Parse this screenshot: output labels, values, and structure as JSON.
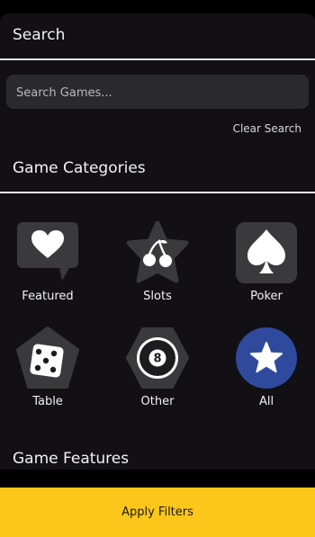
{
  "search": {
    "title": "Search",
    "placeholder": "Search Games...",
    "value": "",
    "clear_label": "Clear Search"
  },
  "categories": {
    "title": "Game Categories",
    "items": [
      {
        "label": "Featured",
        "icon": "heart-speech-bubble-icon"
      },
      {
        "label": "Slots",
        "icon": "cherries-star-icon"
      },
      {
        "label": "Poker",
        "icon": "spade-icon"
      },
      {
        "label": "Table",
        "icon": "dice-pentagon-icon"
      },
      {
        "label": "Other",
        "icon": "eight-ball-hexagon-icon"
      },
      {
        "label": "All",
        "icon": "star-circle-icon"
      }
    ]
  },
  "features": {
    "title": "Game Features"
  },
  "footer": {
    "apply_label": "Apply Filters"
  },
  "colors": {
    "accent": "#fdc61a",
    "panel": "#121014",
    "icon_bg": "#3a3a3c",
    "all_selected": "#2f4a9c"
  }
}
